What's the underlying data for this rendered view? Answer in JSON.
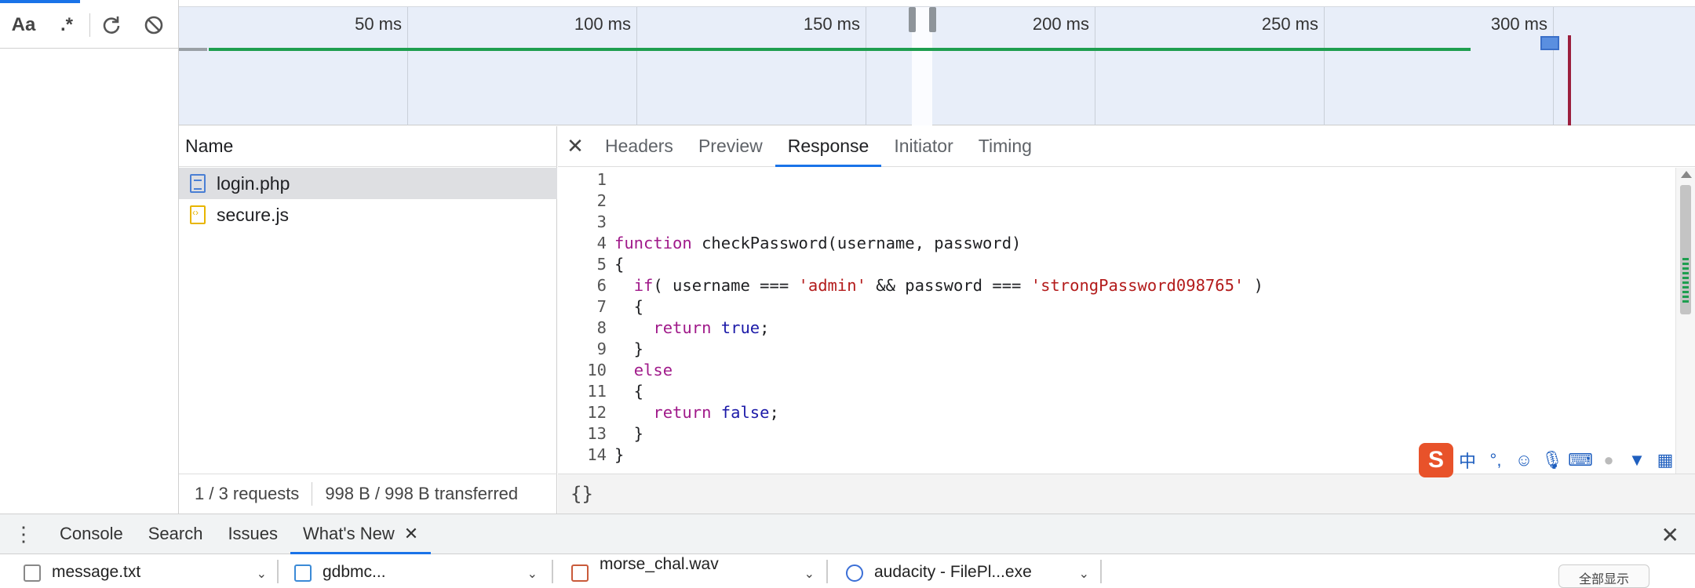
{
  "filter_toolbar": {
    "case_sensitive_label": "Aa",
    "regex_label": ".*"
  },
  "timeline": {
    "ticks": [
      "50 ms",
      "100 ms",
      "150 ms",
      "200 ms",
      "250 ms",
      "300 ms"
    ]
  },
  "requests": {
    "header": "Name",
    "items": [
      {
        "name": "login.php",
        "type": "document",
        "selected": true
      },
      {
        "name": "secure.js",
        "type": "script",
        "selected": false
      }
    ],
    "status": {
      "count": "1 / 3 requests",
      "transferred": "998 B / 998 B transferred"
    }
  },
  "detail": {
    "tabs": [
      "Headers",
      "Preview",
      "Response",
      "Initiator",
      "Timing"
    ],
    "active_tab": "Response",
    "pretty_print_label": "{}",
    "code_lines": [
      {
        "n": "1",
        "text": ""
      },
      {
        "n": "2",
        "text": ""
      },
      {
        "n": "3",
        "text": ""
      },
      {
        "n": "4",
        "text": "function checkPassword(username, password)"
      },
      {
        "n": "5",
        "text": "{"
      },
      {
        "n": "6",
        "text": "  if( username === 'admin' && password === 'strongPassword098765' )"
      },
      {
        "n": "7",
        "text": "  {"
      },
      {
        "n": "8",
        "text": "    return true;"
      },
      {
        "n": "9",
        "text": "  }"
      },
      {
        "n": "10",
        "text": "  else"
      },
      {
        "n": "11",
        "text": "  {"
      },
      {
        "n": "12",
        "text": "    return false;"
      },
      {
        "n": "13",
        "text": "  }"
      },
      {
        "n": "14",
        "text": "}"
      }
    ]
  },
  "ime": {
    "logo": "S",
    "mode_label": "中",
    "punct_label": "°,"
  },
  "drawer": {
    "tabs": [
      "Console",
      "Search",
      "Issues",
      "What's New"
    ],
    "active_tab": "What's New"
  },
  "taskbar": {
    "items": [
      "message.txt",
      "gdbmc...",
      "morse_chal.wav",
      "audacity - FilePl...exe"
    ],
    "button_label": "全部显示"
  },
  "colors": {
    "accent": "#1a73e8",
    "timeline_bg": "#e8eef9",
    "keyword": "#a01a8a",
    "string": "#b31b1b",
    "literal": "#1c1aa8",
    "waterfall_green": "#1e9e4f"
  }
}
